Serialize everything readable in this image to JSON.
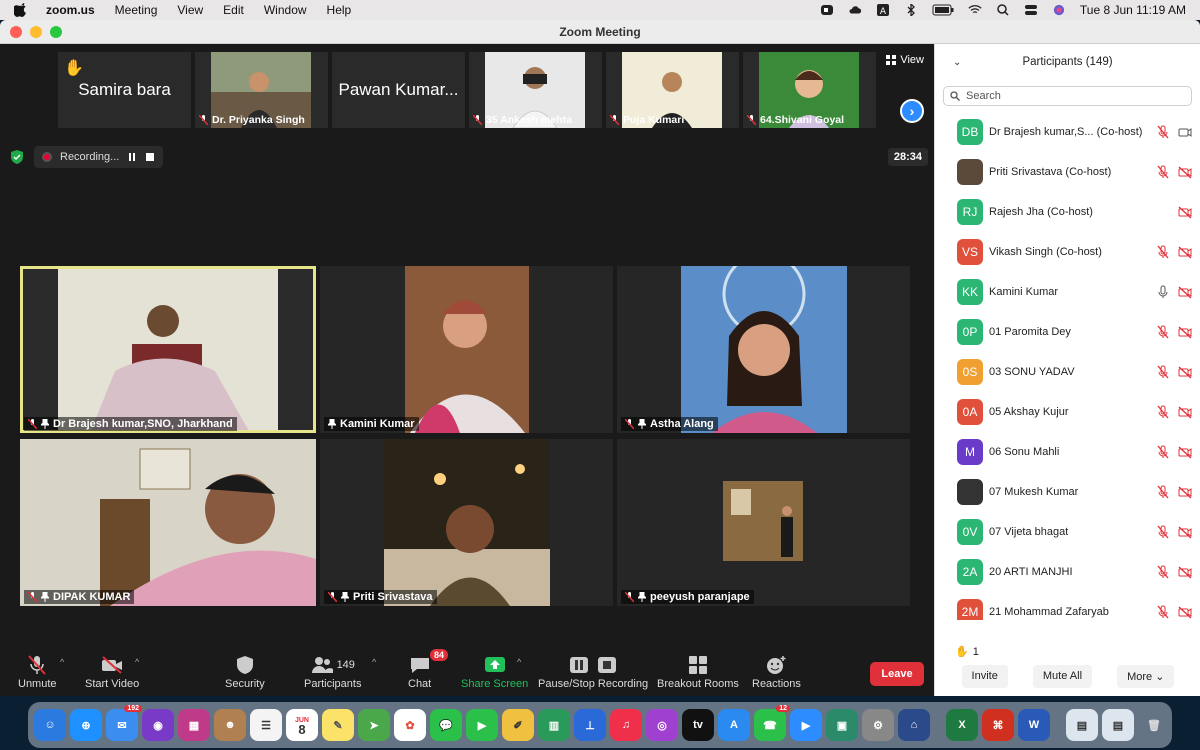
{
  "menubar": {
    "app": "zoom.us",
    "items": [
      "Meeting",
      "View",
      "Edit",
      "Window",
      "Help"
    ],
    "datetime": "Tue 8 Jun  11:19 AM"
  },
  "window": {
    "title": "Zoom Meeting"
  },
  "strip": {
    "tiles": [
      {
        "name": "Samira bara",
        "hand": "✋"
      },
      {
        "name": "Dr. Priyanka Singh"
      },
      {
        "name": "Pawan Kumar..."
      },
      {
        "name": "35 Ankesh mehta"
      },
      {
        "name": "Puja Kumari"
      },
      {
        "name": "64.Shivani Goyal"
      }
    ],
    "view_label": "View"
  },
  "recording": {
    "label": "Recording...",
    "timer": "28:34"
  },
  "grid": [
    {
      "name": "Dr Brajesh kumar,SNO, Jharkhand",
      "active": true
    },
    {
      "name": "Kamini Kumar"
    },
    {
      "name": "Astha Alang"
    },
    {
      "name": "DIPAK KUMAR"
    },
    {
      "name": "Priti Srivastava"
    },
    {
      "name": "peeyush paranjape"
    }
  ],
  "toolbar": {
    "unmute": "Unmute",
    "start_video": "Start Video",
    "security": "Security",
    "participants": "Participants",
    "participants_count": "149",
    "chat": "Chat",
    "chat_badge": "84",
    "share": "Share Screen",
    "recording": "Pause/Stop Recording",
    "breakout": "Breakout Rooms",
    "reactions": "Reactions",
    "leave": "Leave"
  },
  "panel": {
    "title": "Participants (149)",
    "search_placeholder": "Search",
    "participants": [
      {
        "initials": "DB",
        "name": "Dr Brajesh kumar,S... (Co-host)",
        "color": "#2bb673",
        "mic": "muted",
        "video": "on"
      },
      {
        "initials": "",
        "name": "Priti Srivastava (Co-host)",
        "color": "#5b4a3a",
        "mic": "muted",
        "video": "off"
      },
      {
        "initials": "RJ",
        "name": "Rajesh Jha (Co-host)",
        "color": "#2bb673",
        "mic": "none",
        "video": "off"
      },
      {
        "initials": "VS",
        "name": "Vikash Singh (Co-host)",
        "color": "#e0503a",
        "mic": "muted",
        "video": "off"
      },
      {
        "initials": "KK",
        "name": "Kamini Kumar",
        "color": "#2bb673",
        "mic": "on",
        "video": "off"
      },
      {
        "initials": "0P",
        "name": "01 Paromita Dey",
        "color": "#2bb673",
        "mic": "muted",
        "video": "off"
      },
      {
        "initials": "0S",
        "name": "03 SONU YADAV",
        "color": "#f0a030",
        "mic": "muted",
        "video": "off"
      },
      {
        "initials": "0A",
        "name": "05 Akshay Kujur",
        "color": "#e0503a",
        "mic": "muted",
        "video": "off"
      },
      {
        "initials": "M",
        "name": "06 Sonu Mahli",
        "color": "#6a3ac8",
        "mic": "muted",
        "video": "off"
      },
      {
        "initials": "",
        "name": "07 Mukesh Kumar",
        "color": "#333333",
        "mic": "muted",
        "video": "off"
      },
      {
        "initials": "0V",
        "name": "07 Vijeta bhagat",
        "color": "#2bb673",
        "mic": "muted",
        "video": "off"
      },
      {
        "initials": "2A",
        "name": "20 ARTI MANJHI",
        "color": "#2bb673",
        "mic": "muted",
        "video": "off"
      },
      {
        "initials": "2M",
        "name": "21 Mohammad Zafaryab",
        "color": "#e0503a",
        "mic": "muted",
        "video": "off"
      }
    ],
    "raised_hands": "1",
    "invite": "Invite",
    "mute_all": "Mute All",
    "more": "More"
  },
  "dock": {
    "mail_badge": "192",
    "calendar_month": "JUN",
    "calendar_day": "8",
    "whatsapp_badge": "12",
    "tv_label": "tv"
  }
}
